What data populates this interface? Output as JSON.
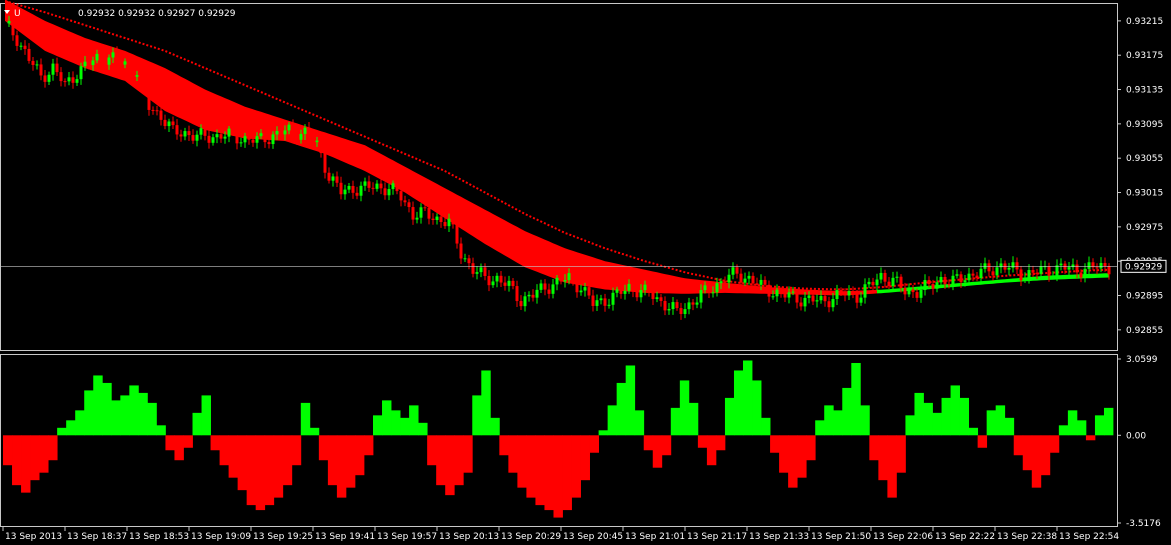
{
  "header": {
    "symbol": "U",
    "ohlc": "0.92932 0.92932 0.92927 0.92929"
  },
  "chart_data": [
    {
      "type": "candlestick",
      "panel": "price",
      "ylim": [
        0.92835,
        0.9323
      ],
      "price_ticks": [
        "0.93215",
        "0.93175",
        "0.93135",
        "0.93095",
        "0.93055",
        "0.93015",
        "0.92975",
        "0.92935",
        "0.92895",
        "0.92855"
      ],
      "current_price": "0.92929",
      "x_labels": [
        "13 Sep 2013",
        "13 Sep 18:37",
        "13 Sep 18:53",
        "13 Sep 19:09",
        "13 Sep 19:25",
        "13 Sep 19:41",
        "13 Sep 19:57",
        "13 Sep 20:13",
        "13 Sep 20:29",
        "13 Sep 20:45",
        "13 Sep 21:01",
        "13 Sep 21:17",
        "13 Sep 21:33",
        "13 Sep 21:50",
        "13 Sep 22:06",
        "13 Sep 22:22",
        "13 Sep 22:38",
        "13 Sep 22:54"
      ],
      "close_path": [
        [
          0,
          0.93212
        ],
        [
          3,
          0.93195
        ],
        [
          6,
          0.9317
        ],
        [
          9,
          0.9315
        ],
        [
          12,
          0.9316
        ],
        [
          15,
          0.9314
        ],
        [
          18,
          0.93155
        ],
        [
          21,
          0.93165
        ],
        [
          24,
          0.93175
        ],
        [
          27,
          0.9317
        ],
        [
          30,
          0.93165
        ],
        [
          33,
          0.93155
        ],
        [
          36,
          0.93115
        ],
        [
          39,
          0.93105
        ],
        [
          42,
          0.93085
        ],
        [
          45,
          0.93085
        ],
        [
          48,
          0.9308
        ],
        [
          51,
          0.9308
        ],
        [
          54,
          0.93082
        ],
        [
          57,
          0.9308
        ],
        [
          60,
          0.93078
        ],
        [
          63,
          0.93075
        ],
        [
          66,
          0.9308
        ],
        [
          69,
          0.93085
        ],
        [
          72,
          0.93087
        ],
        [
          75,
          0.93085
        ],
        [
          78,
          0.9307
        ],
        [
          81,
          0.93035
        ],
        [
          84,
          0.93015
        ],
        [
          87,
          0.9302
        ],
        [
          90,
          0.9302
        ],
        [
          93,
          0.93022
        ],
        [
          96,
          0.9302
        ],
        [
          99,
          0.9301
        ],
        [
          102,
          0.9299
        ],
        [
          105,
          0.9299
        ],
        [
          108,
          0.92985
        ],
        [
          111,
          0.9298
        ],
        [
          114,
          0.92945
        ],
        [
          117,
          0.92925
        ],
        [
          120,
          0.92915
        ],
        [
          123,
          0.92915
        ],
        [
          126,
          0.92905
        ],
        [
          129,
          0.9289
        ],
        [
          132,
          0.92895
        ],
        [
          135,
          0.92905
        ],
        [
          138,
          0.9291
        ],
        [
          141,
          0.92915
        ],
        [
          144,
          0.92905
        ],
        [
          147,
          0.92885
        ],
        [
          150,
          0.9289
        ],
        [
          153,
          0.92895
        ],
        [
          156,
          0.92905
        ],
        [
          159,
          0.929
        ],
        [
          162,
          0.92895
        ],
        [
          165,
          0.92885
        ],
        [
          168,
          0.92875
        ],
        [
          171,
          0.92885
        ],
        [
          174,
          0.92895
        ],
        [
          177,
          0.92905
        ],
        [
          180,
          0.92915
        ],
        [
          183,
          0.9292
        ],
        [
          186,
          0.92915
        ],
        [
          189,
          0.92905
        ],
        [
          192,
          0.929
        ],
        [
          195,
          0.92895
        ],
        [
          198,
          0.92892
        ],
        [
          201,
          0.9289
        ],
        [
          204,
          0.92888
        ],
        [
          207,
          0.92893
        ],
        [
          210,
          0.92897
        ],
        [
          213,
          0.92895
        ],
        [
          216,
          0.92905
        ],
        [
          219,
          0.92918
        ],
        [
          222,
          0.92912
        ],
        [
          225,
          0.929
        ],
        [
          228,
          0.929
        ],
        [
          231,
          0.92905
        ],
        [
          234,
          0.92915
        ],
        [
          237,
          0.9291
        ],
        [
          240,
          0.92918
        ],
        [
          243,
          0.9292
        ],
        [
          246,
          0.92925
        ],
        [
          249,
          0.9293
        ],
        [
          252,
          0.92925
        ],
        [
          255,
          0.9292
        ],
        [
          258,
          0.92922
        ],
        [
          261,
          0.92925
        ],
        [
          264,
          0.92928
        ],
        [
          267,
          0.92925
        ],
        [
          270,
          0.92926
        ],
        [
          273,
          0.92928
        ],
        [
          276,
          0.92929
        ]
      ],
      "ribbon_upper": [
        [
          0,
          0.9324
        ],
        [
          10,
          0.93215
        ],
        [
          20,
          0.93195
        ],
        [
          30,
          0.9318
        ],
        [
          40,
          0.9316
        ],
        [
          50,
          0.93135
        ],
        [
          60,
          0.93115
        ],
        [
          70,
          0.931
        ],
        [
          80,
          0.93085
        ],
        [
          90,
          0.9307
        ],
        [
          100,
          0.93045
        ],
        [
          110,
          0.9302
        ],
        [
          120,
          0.92995
        ],
        [
          130,
          0.9297
        ],
        [
          140,
          0.9295
        ],
        [
          150,
          0.92935
        ],
        [
          160,
          0.92925
        ],
        [
          170,
          0.92915
        ],
        [
          180,
          0.9291
        ],
        [
          190,
          0.92905
        ],
        [
          200,
          0.92902
        ],
        [
          210,
          0.929
        ],
        [
          220,
          0.92902
        ],
        [
          230,
          0.92906
        ],
        [
          240,
          0.9291
        ],
        [
          250,
          0.92914
        ],
        [
          260,
          0.92918
        ],
        [
          270,
          0.9292
        ],
        [
          276,
          0.92921
        ]
      ],
      "ribbon_lower": [
        [
          0,
          0.93215
        ],
        [
          10,
          0.9318
        ],
        [
          20,
          0.9316
        ],
        [
          30,
          0.93145
        ],
        [
          40,
          0.9311
        ],
        [
          50,
          0.93088
        ],
        [
          60,
          0.93078
        ],
        [
          70,
          0.93075
        ],
        [
          80,
          0.9306
        ],
        [
          90,
          0.9304
        ],
        [
          100,
          0.93015
        ],
        [
          110,
          0.92985
        ],
        [
          120,
          0.92955
        ],
        [
          130,
          0.92928
        ],
        [
          140,
          0.9291
        ],
        [
          150,
          0.92902
        ],
        [
          160,
          0.92898
        ],
        [
          170,
          0.92897
        ],
        [
          180,
          0.92898
        ],
        [
          190,
          0.92897
        ],
        [
          200,
          0.92896
        ],
        [
          210,
          0.92895
        ],
        [
          220,
          0.92898
        ],
        [
          230,
          0.92902
        ],
        [
          240,
          0.92906
        ],
        [
          250,
          0.9291
        ],
        [
          260,
          0.92913
        ],
        [
          270,
          0.92915
        ],
        [
          276,
          0.92916
        ]
      ],
      "ribbon_green_from": 218,
      "slow_ma": [
        [
          0,
          0.93238
        ],
        [
          10,
          0.93225
        ],
        [
          20,
          0.9321
        ],
        [
          30,
          0.93195
        ],
        [
          40,
          0.9318
        ],
        [
          50,
          0.9316
        ],
        [
          60,
          0.9314
        ],
        [
          70,
          0.9312
        ],
        [
          80,
          0.931
        ],
        [
          90,
          0.9308
        ],
        [
          100,
          0.9306
        ],
        [
          110,
          0.9304
        ],
        [
          120,
          0.93015
        ],
        [
          130,
          0.9299
        ],
        [
          140,
          0.92968
        ],
        [
          150,
          0.9295
        ],
        [
          160,
          0.92935
        ],
        [
          170,
          0.92922
        ],
        [
          180,
          0.92912
        ],
        [
          190,
          0.92906
        ],
        [
          200,
          0.92903
        ],
        [
          210,
          0.92902
        ],
        [
          220,
          0.92905
        ],
        [
          230,
          0.9291
        ],
        [
          240,
          0.92914
        ],
        [
          250,
          0.92918
        ],
        [
          260,
          0.92921
        ],
        [
          270,
          0.92924
        ],
        [
          276,
          0.92925
        ]
      ]
    },
    {
      "type": "histogram",
      "panel": "oscillator",
      "ylim": [
        -3.5176,
        3.0599
      ],
      "ticks": [
        "3.0599",
        "0.00",
        "-3.5176"
      ],
      "bars": [
        -1.2,
        -2.0,
        -2.3,
        -1.8,
        -1.5,
        -1.0,
        0.3,
        0.6,
        1.0,
        1.8,
        2.4,
        2.1,
        1.4,
        1.6,
        2.0,
        1.7,
        1.3,
        0.4,
        -0.6,
        -1.0,
        -0.5,
        0.9,
        1.6,
        -0.6,
        -1.2,
        -1.7,
        -2.2,
        -2.8,
        -3.0,
        -2.8,
        -2.5,
        -2.0,
        -1.2,
        1.3,
        0.3,
        -1.0,
        -2.0,
        -2.5,
        -2.1,
        -1.6,
        -0.8,
        0.8,
        1.4,
        1.0,
        0.7,
        1.2,
        0.5,
        -1.2,
        -2.0,
        -2.4,
        -2.0,
        -1.5,
        1.6,
        2.6,
        0.7,
        -0.8,
        -1.5,
        -2.1,
        -2.5,
        -2.8,
        -3.0,
        -3.3,
        -3.0,
        -2.5,
        -1.8,
        -0.7,
        0.2,
        1.2,
        2.1,
        2.8,
        1.0,
        -0.6,
        -1.3,
        -0.8,
        1.1,
        2.2,
        1.3,
        -0.5,
        -1.2,
        -0.6,
        1.5,
        2.6,
        3.0,
        2.2,
        0.7,
        -0.7,
        -1.5,
        -2.1,
        -1.7,
        -1.0,
        0.6,
        1.2,
        1.0,
        1.9,
        2.9,
        1.2,
        -1.0,
        -1.8,
        -2.5,
        -1.5,
        0.8,
        1.7,
        1.3,
        0.9,
        1.5,
        2.0,
        1.5,
        0.3,
        -0.5,
        1.0,
        1.2,
        0.7,
        -0.8,
        -1.4,
        -2.1,
        -1.6,
        -0.7,
        0.4,
        1.0,
        0.6,
        -0.2,
        0.8,
        1.1
      ]
    }
  ],
  "colors": {
    "bull": "#00ff00",
    "bear": "#ff0000",
    "background": "#000000",
    "grid_text": "#ffffff",
    "frame": "#c8c8c8"
  }
}
